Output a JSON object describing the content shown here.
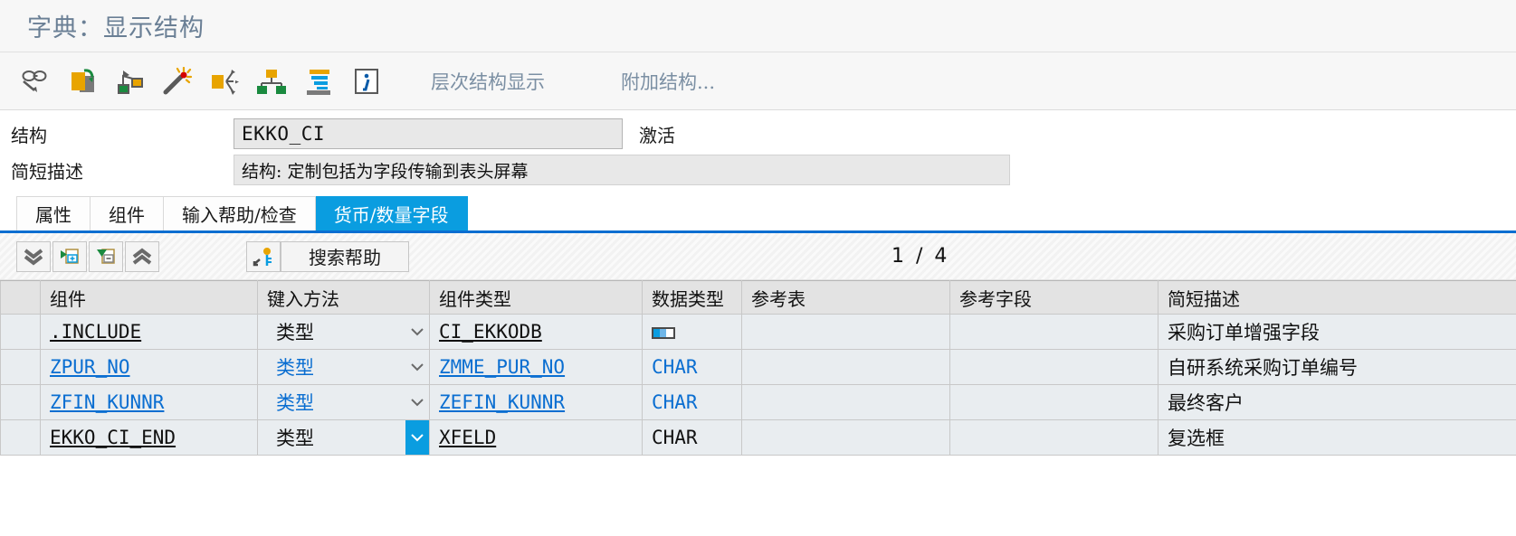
{
  "window": {
    "title": "字典：显示结构"
  },
  "main_toolbar": {
    "icons": [
      {
        "name": "display-change-icon",
        "label": "显示 <-> 更改"
      },
      {
        "name": "other-object-icon",
        "label": "其他对象"
      },
      {
        "name": "where-used-list-icon",
        "label": "使用位置列表"
      },
      {
        "name": "append-wizard-icon",
        "label": "向导"
      },
      {
        "name": "navigate-icon",
        "label": "导航"
      },
      {
        "name": "hierarchy-icon",
        "label": "层次"
      },
      {
        "name": "indexes-icon",
        "label": "索引"
      },
      {
        "name": "info-icon",
        "label": "信息"
      }
    ],
    "buttons": [
      {
        "name": "hierarchy-display-button",
        "label": "层次结构显示"
      },
      {
        "name": "append-structure-button",
        "label": "附加结构..."
      }
    ]
  },
  "form": {
    "structure_label": "结构",
    "structure_value": "EKKO_CI",
    "status": "激活",
    "description_label": "简短描述",
    "description_value": "结构: 定制包括为字段传输到表头屏幕"
  },
  "tabs": [
    {
      "name": "tab-attributes",
      "label": "属性",
      "active": false
    },
    {
      "name": "tab-components",
      "label": "组件",
      "active": false
    },
    {
      "name": "tab-input-help",
      "label": "输入帮助/检查",
      "active": false
    },
    {
      "name": "tab-currency-quantity",
      "label": "货币/数量字段",
      "active": true
    }
  ],
  "grid_toolbar": {
    "buttons": [
      {
        "name": "scroll-to-bottom-button",
        "icon": "double-chevron-down-icon"
      },
      {
        "name": "insert-row-button",
        "icon": "insert-row-icon"
      },
      {
        "name": "delete-row-button",
        "icon": "delete-row-icon"
      },
      {
        "name": "scroll-to-top-button",
        "icon": "double-chevron-up-icon"
      }
    ],
    "srch_help_icon": "key-icon",
    "search_help_label": "搜索帮助",
    "page_current": "1",
    "page_separator": "/",
    "page_total": "4"
  },
  "table": {
    "columns": [
      {
        "name": "col-select",
        "label": ""
      },
      {
        "name": "col-component",
        "label": "组件"
      },
      {
        "name": "col-typing-method",
        "label": "键入方法"
      },
      {
        "name": "col-component-type",
        "label": "组件类型"
      },
      {
        "name": "col-data-type",
        "label": "数据类型"
      },
      {
        "name": "col-reference-table",
        "label": "参考表"
      },
      {
        "name": "col-reference-field",
        "label": "参考字段"
      },
      {
        "name": "col-short-description",
        "label": "简短描述"
      }
    ],
    "rows": [
      {
        "component": ".INCLUDE",
        "component_style": "dark-link",
        "typing_method": "类型",
        "typing_style": "plain",
        "dropdown_highlighted": false,
        "component_type": "CI_EKKODB",
        "component_type_style": "dark-link",
        "data_type": "",
        "data_type_icon": "structure-icon",
        "data_type_style": "plain",
        "reference_table": "",
        "reference_field": "",
        "short_description": "采购订单增强字段",
        "description_style": "plain"
      },
      {
        "component": "ZPUR_NO",
        "component_style": "link",
        "typing_method": "类型",
        "typing_style": "blue-txt",
        "dropdown_highlighted": false,
        "component_type": "ZMME_PUR_NO",
        "component_type_style": "link",
        "data_type": "CHAR",
        "data_type_icon": "",
        "data_type_style": "blue-txt",
        "reference_table": "",
        "reference_field": "",
        "short_description": "自研系统采购订单编号",
        "description_style": "blue-txt"
      },
      {
        "component": "ZFIN_KUNNR",
        "component_style": "link",
        "typing_method": "类型",
        "typing_style": "blue-txt",
        "dropdown_highlighted": false,
        "component_type": "ZEFIN_KUNNR",
        "component_type_style": "link",
        "data_type": "CHAR",
        "data_type_icon": "",
        "data_type_style": "blue-txt",
        "reference_table": "",
        "reference_field": "",
        "short_description": "最终客户",
        "description_style": "blue-txt"
      },
      {
        "component": "EKKO_CI_END",
        "component_style": "dark-link",
        "typing_method": "类型",
        "typing_style": "plain",
        "dropdown_highlighted": true,
        "component_type": "XFELD",
        "component_type_style": "dark-link",
        "data_type": "CHAR",
        "data_type_icon": "",
        "data_type_style": "plain",
        "reference_table": "",
        "reference_field": "",
        "short_description": "复选框",
        "description_style": "plain"
      }
    ]
  },
  "colors": {
    "accent_blue": "#0a9de0",
    "link_blue": "#0a6ed1",
    "title_grey": "#6a7f95",
    "sap_gold": "#e8a400",
    "sap_green": "#1a8a3f"
  }
}
